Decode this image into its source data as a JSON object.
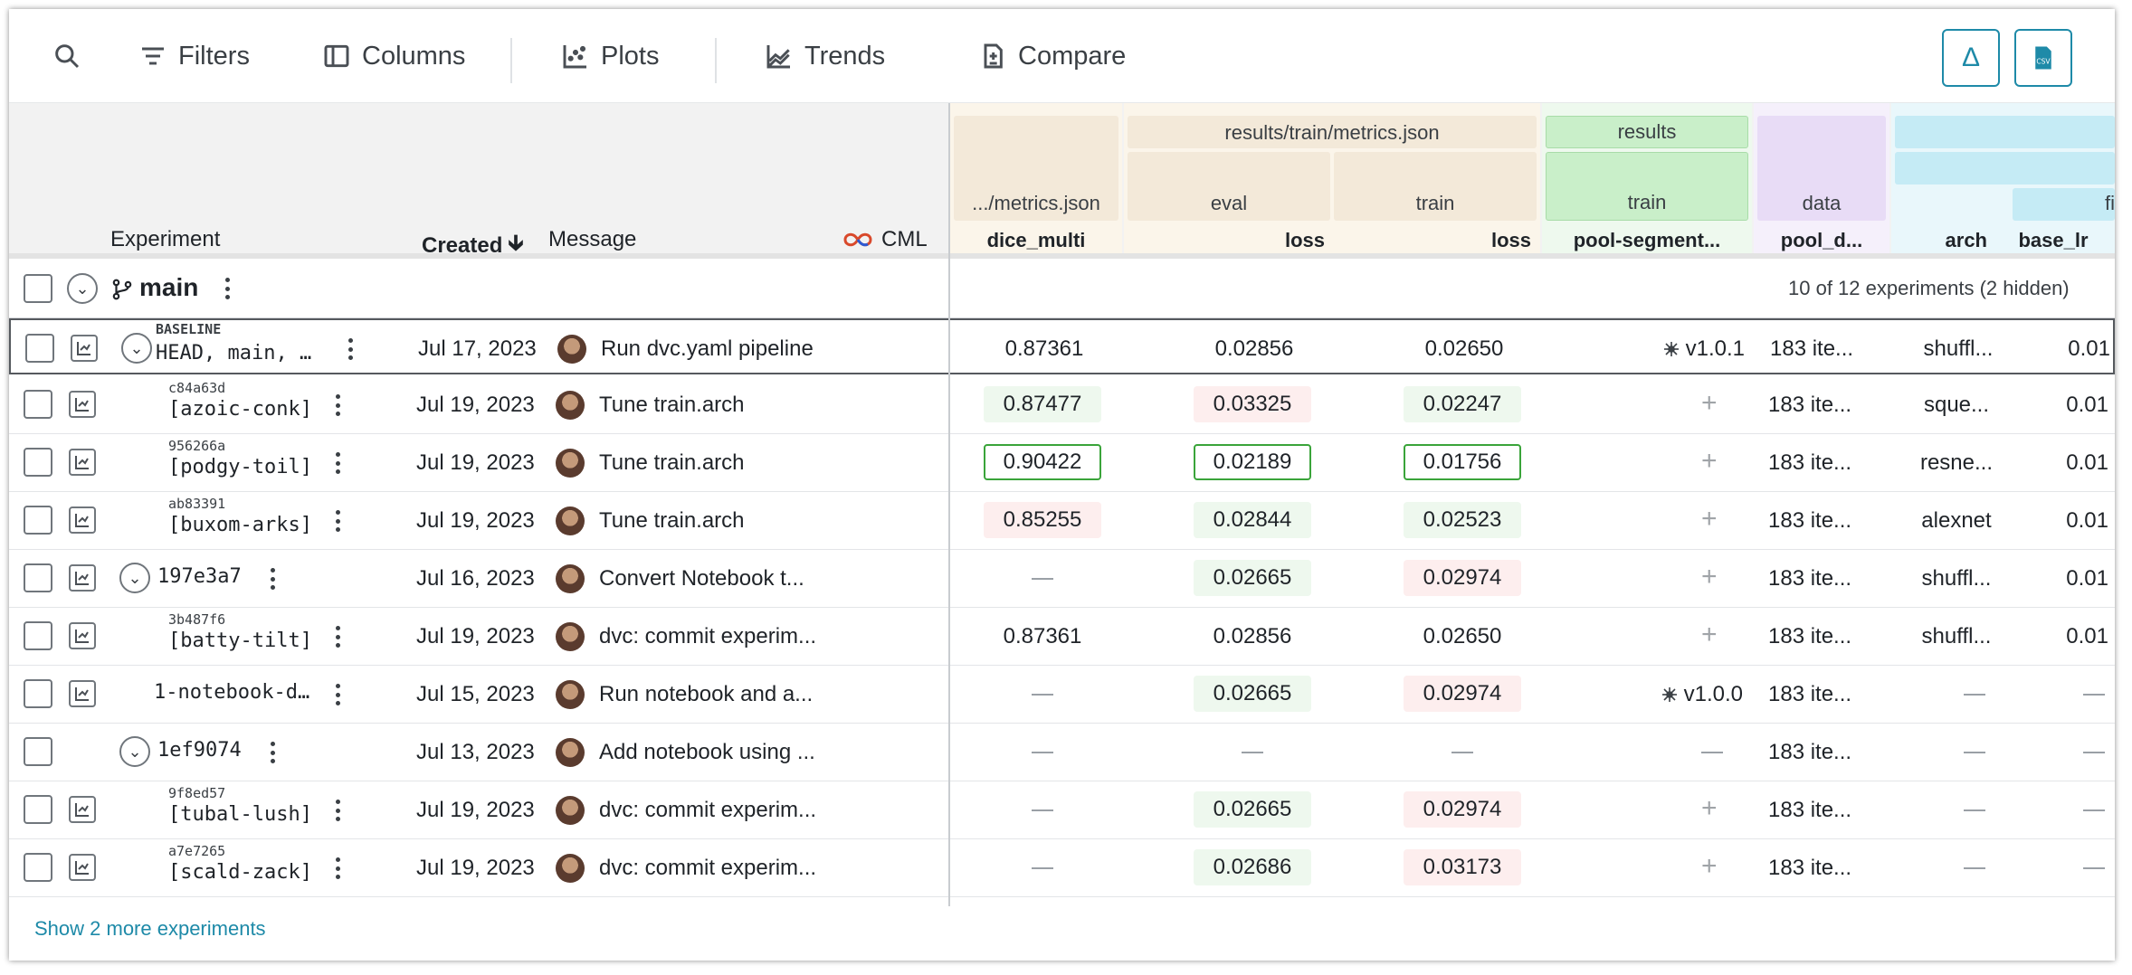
{
  "toolbar": {
    "filters": "Filters",
    "columns": "Columns",
    "plots": "Plots",
    "trends": "Trends",
    "compare": "Compare"
  },
  "header": {
    "experiment": "Experiment",
    "created": "Created",
    "message": "Message",
    "cml": "CML",
    "groups": {
      "metrics_file_short": ".../metrics.json",
      "results_train_metrics": "results/train/metrics.json",
      "eval": "eval",
      "train": "train",
      "results": "results",
      "results_train": "train",
      "data": "data"
    },
    "columns": {
      "dice_multi": "dice_multi",
      "loss_eval": "loss",
      "loss_train": "loss",
      "pool_segment": "pool-segment...",
      "pool_d": "pool_d...",
      "arch": "arch",
      "base_lr": "base_lr",
      "fi": "fi"
    }
  },
  "main": {
    "branch": "main",
    "summary": "10 of 12 experiments (2 hidden)"
  },
  "rows": [
    {
      "sha": "BASELINE",
      "name": "HEAD, main, …",
      "date": "Jul 17, 2023",
      "message": "Run dvc.yaml pipeline",
      "dice": "0.87361",
      "loss_eval": "0.02856",
      "loss_train": "0.02650",
      "pool": "v1.0.1",
      "pool_d": "183 ite...",
      "arch": "shuffl...",
      "lr": "0.01"
    },
    {
      "sha": "c84a63d",
      "name": "[azoic-conk]",
      "date": "Jul 19, 2023",
      "message": "Tune train.arch",
      "dice": "0.87477",
      "loss_eval": "0.03325",
      "loss_train": "0.02247",
      "pool": "+",
      "pool_d": "183 ite...",
      "arch": "sque...",
      "lr": "0.01"
    },
    {
      "sha": "956266a",
      "name": "[podgy-toil]",
      "date": "Jul 19, 2023",
      "message": "Tune train.arch",
      "dice": "0.90422",
      "loss_eval": "0.02189",
      "loss_train": "0.01756",
      "pool": "+",
      "pool_d": "183 ite...",
      "arch": "resne...",
      "lr": "0.01"
    },
    {
      "sha": "ab83391",
      "name": "[buxom-arks]",
      "date": "Jul 19, 2023",
      "message": "Tune train.arch",
      "dice": "0.85255",
      "loss_eval": "0.02844",
      "loss_train": "0.02523",
      "pool": "+",
      "pool_d": "183 ite...",
      "arch": "alexnet",
      "lr": "0.01"
    },
    {
      "sha": "",
      "name": "197e3a7",
      "date": "Jul 16, 2023",
      "message": "Convert Notebook t...",
      "dice": "—",
      "loss_eval": "0.02665",
      "loss_train": "0.02974",
      "pool": "+",
      "pool_d": "183 ite...",
      "arch": "shuffl...",
      "lr": "0.01"
    },
    {
      "sha": "3b487f6",
      "name": "[batty-tilt]",
      "date": "Jul 19, 2023",
      "message": "dvc: commit experim...",
      "dice": "0.87361",
      "loss_eval": "0.02856",
      "loss_train": "0.02650",
      "pool": "+",
      "pool_d": "183 ite...",
      "arch": "shuffl...",
      "lr": "0.01"
    },
    {
      "sha": "",
      "name": "1-notebook-d…",
      "date": "Jul 15, 2023",
      "message": "Run notebook and a...",
      "dice": "—",
      "loss_eval": "0.02665",
      "loss_train": "0.02974",
      "pool": "v1.0.0",
      "pool_d": "183 ite...",
      "arch": "—",
      "lr": "—"
    },
    {
      "sha": "",
      "name": "1ef9074",
      "date": "Jul 13, 2023",
      "message": "Add notebook using ...",
      "dice": "—",
      "loss_eval": "—",
      "loss_train": "—",
      "pool": "—",
      "pool_d": "183 ite...",
      "arch": "—",
      "lr": "—"
    },
    {
      "sha": "9f8ed57",
      "name": "[tubal-lush]",
      "date": "Jul 19, 2023",
      "message": "dvc: commit experim...",
      "dice": "—",
      "loss_eval": "0.02665",
      "loss_train": "0.02974",
      "pool": "+",
      "pool_d": "183 ite...",
      "arch": "—",
      "lr": "—"
    },
    {
      "sha": "a7e7265",
      "name": "[scald-zack]",
      "date": "Jul 19, 2023",
      "message": "dvc: commit experim...",
      "dice": "—",
      "loss_eval": "0.02686",
      "loss_train": "0.03173",
      "pool": "+",
      "pool_d": "183 ite...",
      "arch": "—",
      "lr": "—"
    }
  ],
  "footer": {
    "show_more": "Show 2 more experiments"
  },
  "colors": {
    "accent": "#1e8aa8",
    "best_border": "#3aa43a",
    "better_bg": "#eef8ee",
    "worse_bg": "#fdeeee"
  }
}
